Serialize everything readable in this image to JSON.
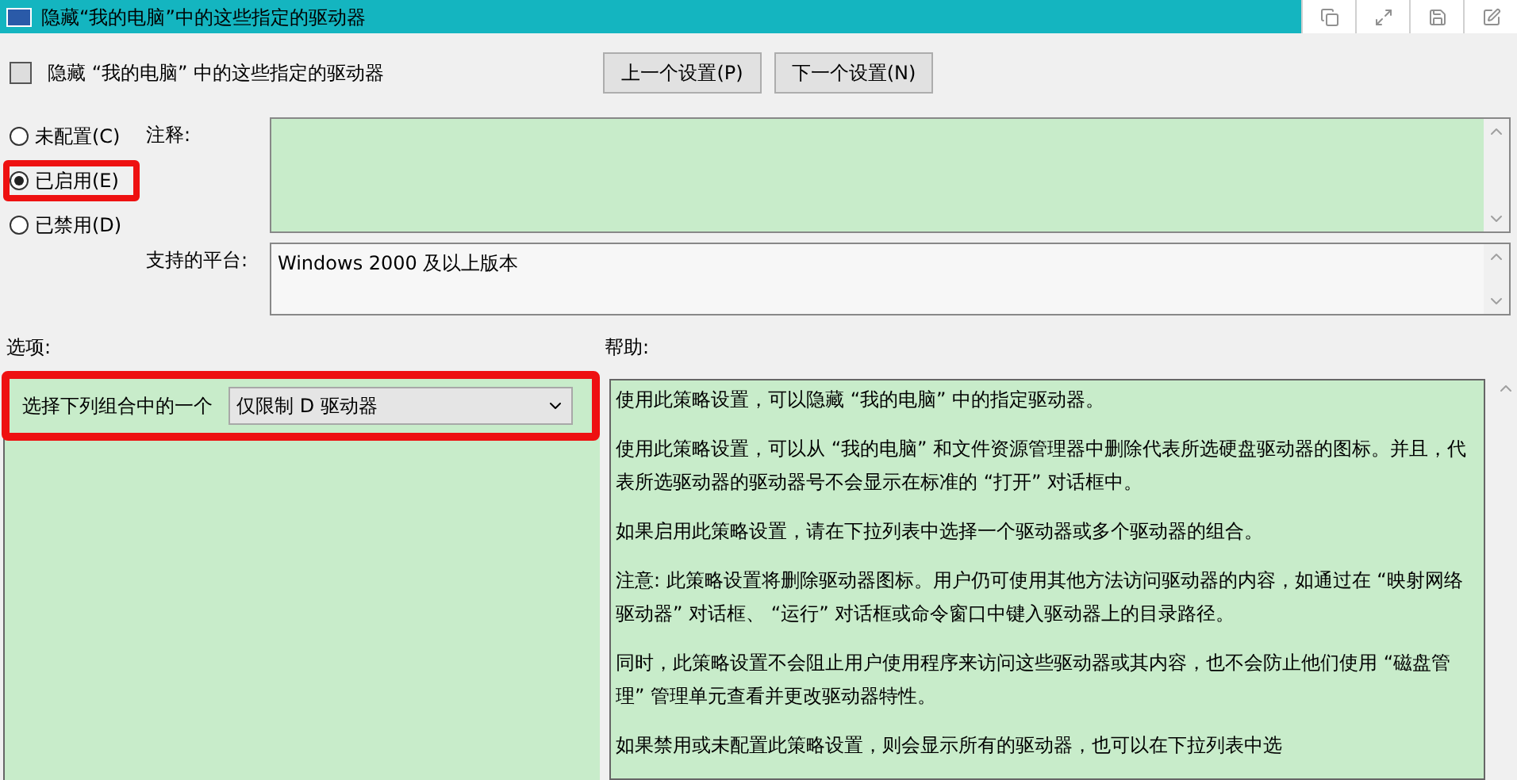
{
  "window": {
    "title": "隐藏“我的电脑”中的这些指定的驱动器"
  },
  "title_bar_buttons": [
    {
      "kind": "restore"
    },
    {
      "kind": "expand"
    },
    {
      "kind": "save"
    },
    {
      "kind": "edit"
    }
  ],
  "policy_title": "隐藏 “我的电脑” 中的这些指定的驱动器",
  "nav_buttons": [
    "上一个设置(P)",
    "下一个设置(N)"
  ],
  "states": [
    {
      "label": "未配置(C)",
      "selected": false,
      "highlighted": false
    },
    {
      "label": "已启用(E)",
      "selected": true,
      "highlighted": true
    },
    {
      "label": "已禁用(D)",
      "selected": false,
      "highlighted": false
    }
  ],
  "comment": {
    "label": "注释:"
  },
  "platform": {
    "label": "支持的平台:",
    "value": "Windows 2000 及以上版本"
  },
  "options": {
    "label": "选项:",
    "highlighted": true,
    "field_label": "选择下列组合中的一个",
    "dropdown_value": "仅限制 D 驱动器"
  },
  "help": {
    "label": "帮助:",
    "paragraphs": [
      "使用此策略设置，可以隐藏 “我的电脑” 中的指定驱动器。",
      "使用此策略设置，可以从 “我的电脑” 和文件资源管理器中删除代表所选硬盘驱动器的图标。并且，代表所选驱动器的驱动器号不会显示在标准的 “打开” 对话框中。",
      "如果启用此策略设置，请在下拉列表中选择一个驱动器或多个驱动器的组合。",
      "注意: 此策略设置将删除驱动器图标。用户仍可使用其他方法访问驱动器的内容，如通过在 “映射网络驱动器” 对话框、 “运行” 对话框或命令窗口中键入驱动器上的目录路径。",
      "同时，此策略设置不会阻止用户使用程序来访问这些驱动器或其内容，也不会防止他们使用 “磁盘管理” 管理单元查看并更改驱动器特性。",
      "如果禁用或未配置此策略设置，则会显示所有的驱动器，也可以在下拉列表中选"
    ]
  }
}
